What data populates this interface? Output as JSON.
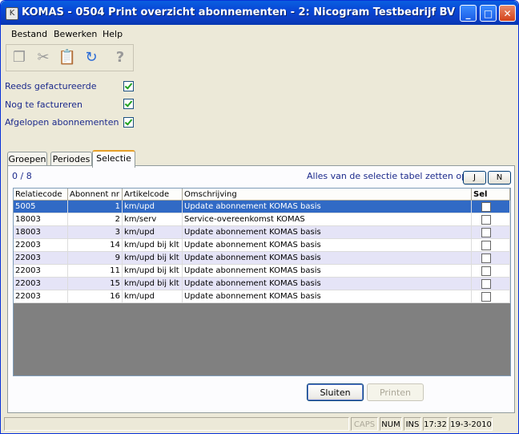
{
  "window": {
    "title": "KOMAS - 0504 Print overzicht abonnementen - 2: Nicogram Testbedrijf BV",
    "buttons": {
      "minimize": "_",
      "maximize": "□",
      "close": "✕"
    }
  },
  "menu": [
    "Bestand",
    "Bewerken",
    "Help"
  ],
  "toolbar": {
    "icons": [
      "copy-icon",
      "cut-icon",
      "paste-icon",
      "refresh-icon",
      "help-icon"
    ],
    "glyphs": {
      "copy": "❐",
      "cut": "✂",
      "paste": "📋",
      "refresh": "↻",
      "help": "?"
    }
  },
  "options": [
    {
      "label": "Reeds gefactureerde",
      "checked": true
    },
    {
      "label": "Nog te factureren",
      "checked": true
    },
    {
      "label": "Afgelopen abonnementen",
      "checked": true
    }
  ],
  "tabs": [
    "Groepen",
    "Periodes",
    "Selectie"
  ],
  "active_tab": "Selectie",
  "selection": {
    "count": "0 / 8",
    "set_all_text": "Alles van de selectie tabel zetten op",
    "yes_label": "J",
    "no_label": "N"
  },
  "table": {
    "columns": [
      "Relatiecode",
      "Abonnent nr",
      "Artikelcode",
      "Omschrijving",
      "Sel"
    ],
    "rows": [
      {
        "relatiecode": "5005",
        "abonnent": "1",
        "artikel": "km/upd",
        "omschrijving": "Update abonnement KOMAS basis",
        "sel": false,
        "selected": true
      },
      {
        "relatiecode": "18003",
        "abonnent": "2",
        "artikel": "km/serv",
        "omschrijving": "Service-overeenkomst KOMAS",
        "sel": false
      },
      {
        "relatiecode": "18003",
        "abonnent": "3",
        "artikel": "km/upd",
        "omschrijving": "Update abonnement KOMAS basis",
        "sel": false
      },
      {
        "relatiecode": "22003",
        "abonnent": "14",
        "artikel": "km/upd bij klt",
        "omschrijving": "Update abonnement KOMAS basis",
        "sel": false
      },
      {
        "relatiecode": "22003",
        "abonnent": "9",
        "artikel": "km/upd bij klt",
        "omschrijving": "Update abonnement KOMAS basis",
        "sel": false
      },
      {
        "relatiecode": "22003",
        "abonnent": "11",
        "artikel": "km/upd bij klt",
        "omschrijving": "Update abonnement KOMAS basis",
        "sel": false
      },
      {
        "relatiecode": "22003",
        "abonnent": "15",
        "artikel": "km/upd bij klt",
        "omschrijving": "Update abonnement KOMAS basis",
        "sel": false
      },
      {
        "relatiecode": "22003",
        "abonnent": "16",
        "artikel": "km/upd",
        "omschrijving": "Update abonnement KOMAS basis",
        "sel": false
      }
    ]
  },
  "buttons": {
    "close_label": "Sluiten",
    "print_label": "Printen"
  },
  "status": {
    "caps": "CAPS",
    "num": "NUM",
    "ins": "INS",
    "time": "17:32",
    "date": "19-3-2010"
  },
  "colors": {
    "selected_row": "#316ac5",
    "alt_row": "#e5e4f7",
    "label_blue": "#1c2a8c"
  }
}
